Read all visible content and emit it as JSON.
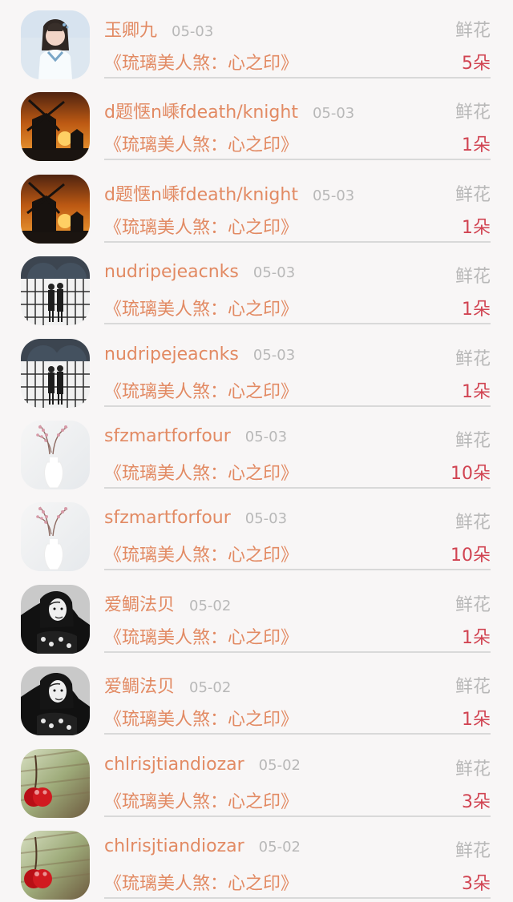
{
  "items": [
    {
      "username": "玉卿九",
      "date": "05-03",
      "gift": "鲜花",
      "book": "《琉璃美人煞：心之印》",
      "count": "5朵",
      "avatar": "portrait-person"
    },
    {
      "username": "d题惬n嵊fdeath/knight",
      "date": "05-03",
      "gift": "鲜花",
      "book": "《琉璃美人煞：心之印》",
      "count": "1朵",
      "avatar": "windmill-sunset"
    },
    {
      "username": "d题惬n嵊fdeath/knight",
      "date": "05-03",
      "gift": "鲜花",
      "book": "《琉璃美人煞：心之印》",
      "count": "1朵",
      "avatar": "windmill-sunset"
    },
    {
      "username": "nudripejeacnks",
      "date": "05-03",
      "gift": "鲜花",
      "book": "《琉璃美人煞：心之印》",
      "count": "1朵",
      "avatar": "couple-window"
    },
    {
      "username": "nudripejeacnks",
      "date": "05-03",
      "gift": "鲜花",
      "book": "《琉璃美人煞：心之印》",
      "count": "1朵",
      "avatar": "couple-window"
    },
    {
      "username": "sfzmartforfour",
      "date": "05-03",
      "gift": "鲜花",
      "book": "《琉璃美人煞：心之印》",
      "count": "10朵",
      "avatar": "flower-vase"
    },
    {
      "username": "sfzmartforfour",
      "date": "05-03",
      "gift": "鲜花",
      "book": "《琉璃美人煞：心之印》",
      "count": "10朵",
      "avatar": "flower-vase"
    },
    {
      "username": "爱鲷法贝",
      "date": "05-02",
      "gift": "鲜花",
      "book": "《琉璃美人煞：心之印》",
      "count": "1朵",
      "avatar": "bw-portrait"
    },
    {
      "username": "爱鲷法贝",
      "date": "05-02",
      "gift": "鲜花",
      "book": "《琉璃美人煞：心之印》",
      "count": "1朵",
      "avatar": "bw-portrait"
    },
    {
      "username": "chlrisjtiandiozar",
      "date": "05-02",
      "gift": "鲜花",
      "book": "《琉璃美人煞：心之印》",
      "count": "3朵",
      "avatar": "cherry"
    },
    {
      "username": "chlrisjtiandiozar",
      "date": "05-02",
      "gift": "鲜花",
      "book": "《琉璃美人煞：心之印》",
      "count": "3朵",
      "avatar": "cherry"
    }
  ]
}
